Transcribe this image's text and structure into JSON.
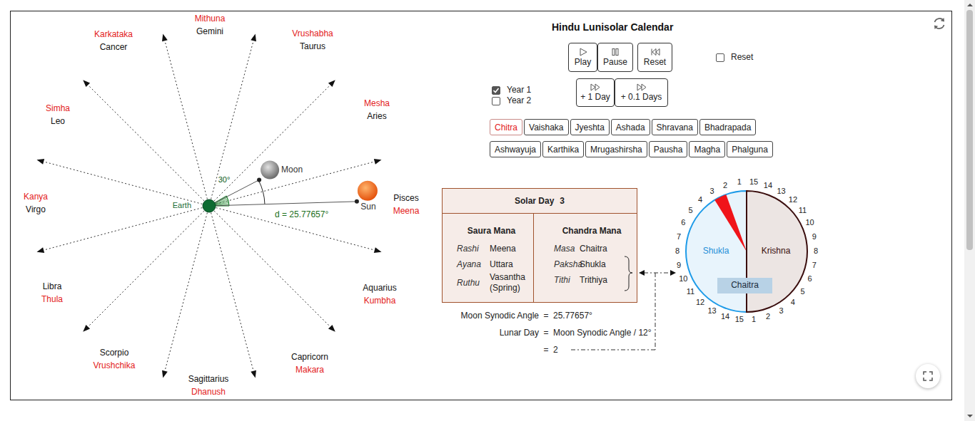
{
  "app": {
    "title": "Hindu Lunisolar Calendar"
  },
  "playback_buttons": [
    {
      "label": "Play",
      "kind": "play"
    },
    {
      "label": "Pause",
      "kind": "pause"
    },
    {
      "label": "Reset",
      "kind": "rewind"
    }
  ],
  "reset_checkbox": {
    "label": "Reset",
    "checked": false
  },
  "years": [
    {
      "label": "Year 1",
      "checked": true
    },
    {
      "label": "Year 2",
      "checked": false
    }
  ],
  "step_buttons": [
    {
      "label": "+ 1 Day"
    },
    {
      "label": "+ 0.1 Days"
    }
  ],
  "months": [
    {
      "label": "Chitra",
      "selected": true
    },
    {
      "label": "Vaishaka",
      "selected": false
    },
    {
      "label": "Jyeshta",
      "selected": false
    },
    {
      "label": "Ashada",
      "selected": false
    },
    {
      "label": "Shravana",
      "selected": false
    },
    {
      "label": "Bhadrapada",
      "selected": false
    },
    {
      "label": "Ashwayuja",
      "selected": false
    },
    {
      "label": "Karthika",
      "selected": false
    },
    {
      "label": "Mrugashirsha",
      "selected": false
    },
    {
      "label": "Pausha",
      "selected": false
    },
    {
      "label": "Magha",
      "selected": false
    },
    {
      "label": "Phalguna",
      "selected": false
    }
  ],
  "diagram": {
    "signs": [
      {
        "english": "Pisces",
        "sanskrit": "Meena"
      },
      {
        "english": "Aries",
        "sanskrit": "Mesha"
      },
      {
        "english": "Taurus",
        "sanskrit": "Vrushabha"
      },
      {
        "english": "Gemini",
        "sanskrit": "Mithuna"
      },
      {
        "english": "Cancer",
        "sanskrit": "Karkataka"
      },
      {
        "english": "Leo",
        "sanskrit": "Simha"
      },
      {
        "english": "Virgo",
        "sanskrit": "Kanya"
      },
      {
        "english": "Libra",
        "sanskrit": "Thula"
      },
      {
        "english": "Scorpio",
        "sanskrit": "Vrushchika"
      },
      {
        "english": "Sagittarius",
        "sanskrit": "Dhanush"
      },
      {
        "english": "Capricorn",
        "sanskrit": "Makara"
      },
      {
        "english": "Aquarius",
        "sanskrit": "Kumbha"
      }
    ],
    "earth": "Earth",
    "moon": "Moon",
    "sun": "Sun",
    "arc_label": "30°",
    "distance_label": "d = 25.77657°",
    "sun_deg": 1.7,
    "synodic_deg": 25.77657
  },
  "info": {
    "solar_day_label": "Solar Day",
    "solar_day": "3",
    "saura": {
      "title": "Saura Mana",
      "rows": [
        {
          "term": "Rashi",
          "value": "Meena"
        },
        {
          "term": "Ayana",
          "value": "Uttara"
        },
        {
          "term": "Ruthu",
          "value": "Vasantha (Spring)"
        }
      ]
    },
    "chandra": {
      "title": "Chandra Mana",
      "rows": [
        {
          "term": "Masa",
          "value": "Chaitra"
        },
        {
          "term": "Paksha",
          "value": "Shukla"
        },
        {
          "term": "Tithi",
          "value": "Trithiya"
        }
      ]
    }
  },
  "equations": [
    {
      "label": "Moon Synodic Angle",
      "eq": "=",
      "value": "25.77657°"
    },
    {
      "label": "Lunar Day",
      "eq": "=",
      "value": "Moon Synodic Angle / 12°"
    },
    {
      "label": "",
      "eq": "=",
      "value": "2"
    }
  ],
  "dial": {
    "shukla": "Shukla",
    "krishna": "Krishna",
    "month": "Chaitra",
    "shukla_days": [
      "1",
      "2",
      "3",
      "4",
      "5",
      "6",
      "7",
      "8",
      "9",
      "10",
      "11",
      "12",
      "13",
      "14",
      "15"
    ],
    "krishna_days": [
      "1",
      "2",
      "3",
      "4",
      "5",
      "6",
      "7",
      "8",
      "9",
      "10",
      "11",
      "12",
      "13",
      "14",
      "15"
    ],
    "pointer_deg": 25.77657
  },
  "scrollbar": {
    "level": 0.6
  }
}
